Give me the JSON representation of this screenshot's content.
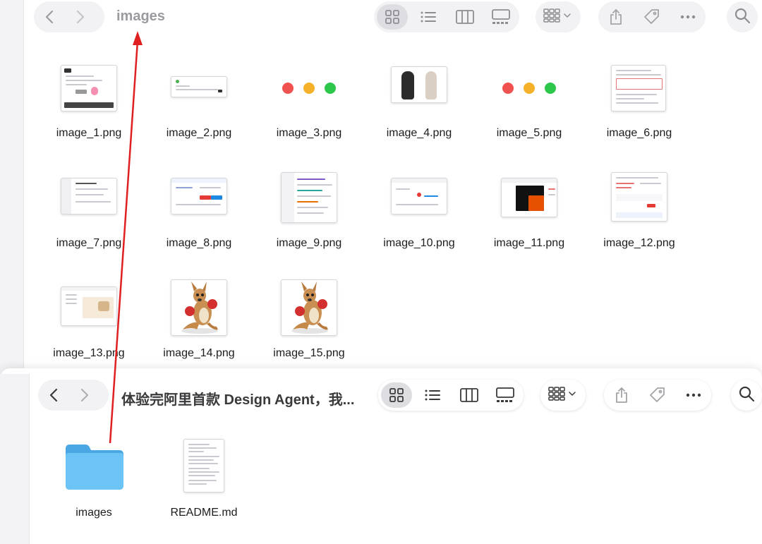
{
  "back_window": {
    "title": "images",
    "files": [
      {
        "name": "image_1.png"
      },
      {
        "name": "image_2.png"
      },
      {
        "name": "image_3.png"
      },
      {
        "name": "image_4.png"
      },
      {
        "name": "image_5.png"
      },
      {
        "name": "image_6.png"
      },
      {
        "name": "image_7.png"
      },
      {
        "name": "image_8.png"
      },
      {
        "name": "image_9.png"
      },
      {
        "name": "image_10.png"
      },
      {
        "name": "image_11.png"
      },
      {
        "name": "image_12.png"
      },
      {
        "name": "image_13.png"
      },
      {
        "name": "image_14.png"
      },
      {
        "name": "image_15.png"
      }
    ]
  },
  "front_window": {
    "title": "体验完阿里首款 Design Agent，我...",
    "items": [
      {
        "name": "images",
        "kind": "folder"
      },
      {
        "name": "README.md",
        "kind": "document"
      }
    ]
  },
  "toolbar_icons": [
    "back-icon",
    "forward-icon",
    "icon-view-icon",
    "list-view-icon",
    "column-view-icon",
    "gallery-view-icon",
    "group-icon",
    "share-icon",
    "tag-icon",
    "more-icon",
    "search-icon"
  ],
  "colors": {
    "traffic_red": "#f0524f",
    "traffic_yellow": "#f5b12a",
    "traffic_green": "#2dc84b",
    "folder_blue": "#5ab8f0",
    "arrow_red": "#e02020"
  }
}
